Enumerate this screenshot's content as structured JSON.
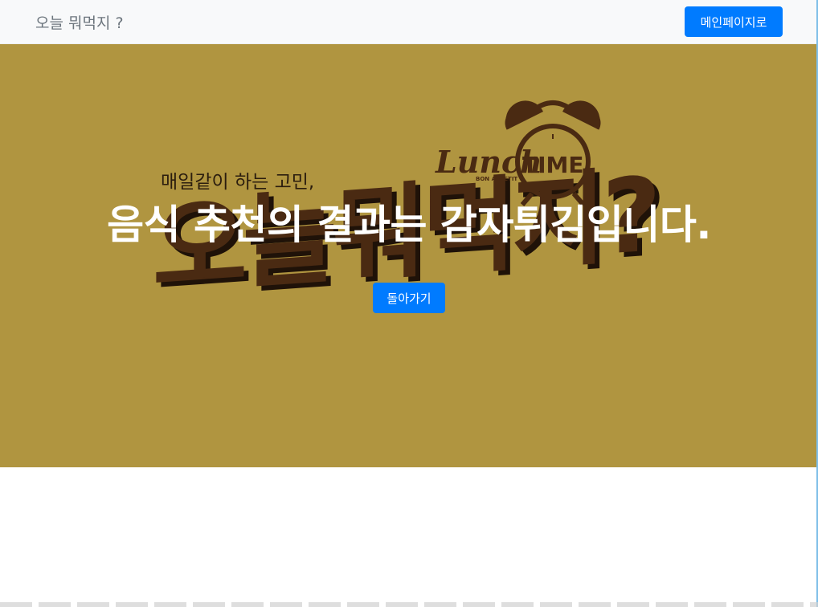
{
  "navbar": {
    "brand": "오늘 뭐먹지 ?",
    "main_page_button": "메인페이지로"
  },
  "hero": {
    "tagline": "매일같이 하는 고민,",
    "big_title_art": "오늘뭐먹지?",
    "logo_lunch": "Lunch",
    "logo_time": "TIME",
    "logo_sub": "BON APPETIT",
    "result_text": "음식 추천의 결과는 감자튀김입니다.",
    "back_button": "돌아가기"
  },
  "colors": {
    "hero_background": "#b09540",
    "art_text": "#4a2a12",
    "button": "#007bff",
    "navbar": "#f8f9fa"
  }
}
